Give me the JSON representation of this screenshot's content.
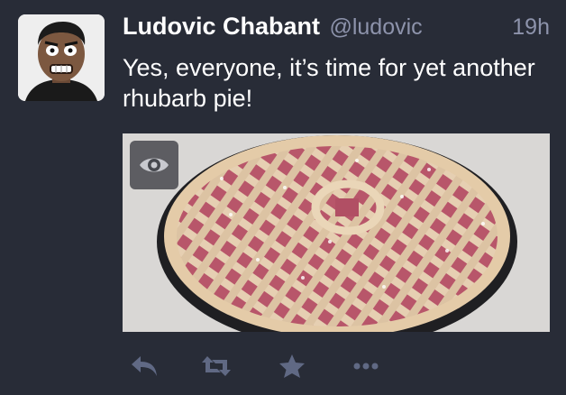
{
  "status": {
    "display_name": "Ludovic Chabant",
    "username": "@ludovic",
    "time": "19h",
    "content": "Yes, everyone, it’s time for yet another rhubarb pie!"
  },
  "media": {
    "toggle_icon": "eye-icon"
  },
  "actions": [
    {
      "icon": "reply-icon"
    },
    {
      "icon": "boost-icon"
    },
    {
      "icon": "favourite-icon"
    },
    {
      "icon": "more-icon"
    }
  ],
  "colors": {
    "background": "#282c37",
    "secondary_text": "#8d93ab",
    "action_icon": "#606984"
  }
}
